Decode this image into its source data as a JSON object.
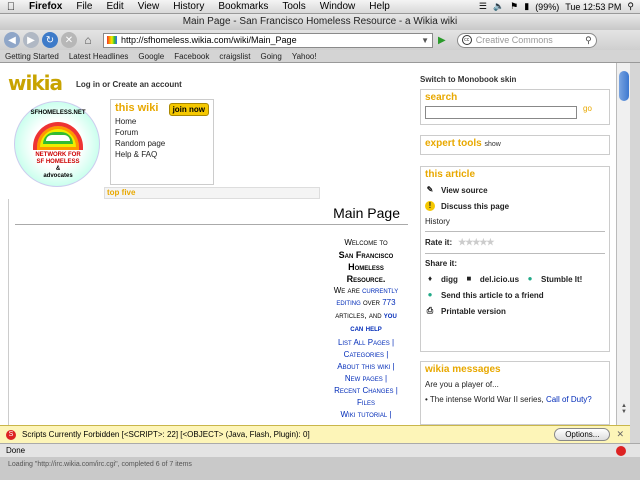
{
  "menubar": {
    "app": "Firefox",
    "items": [
      "File",
      "Edit",
      "View",
      "History",
      "Bookmarks",
      "Tools",
      "Window",
      "Help"
    ],
    "battery": "(99%)",
    "clock": "Tue 12:53 PM"
  },
  "window": {
    "title": "Main Page - San Francisco Homeless Resource - a Wikia wiki"
  },
  "toolbar": {
    "url": "http://sfhomeless.wikia.com/wiki/Main_Page",
    "search_placeholder": "Creative Commons"
  },
  "bookmarks": [
    "Getting Started",
    "Latest Headlines",
    "Google",
    "Facebook",
    "craigslist",
    "Going",
    "Yahoo!"
  ],
  "page": {
    "logo": "wikia",
    "login": "Log in or Create an account",
    "logo_text": {
      "top": "SFHOMELESS.NET",
      "mid1": "NETWORK FOR",
      "mid2": "SF HOMELESS",
      "amp": "&",
      "bot": "advocates"
    },
    "thiswiki": {
      "heading": "this wiki",
      "join": "join now",
      "items": [
        "Home",
        "Forum",
        "Random page",
        "Help & FAQ"
      ]
    },
    "topfive": "top five",
    "article": {
      "title": "Main Page",
      "welcome1": "Welcome to",
      "welcome2": "San Francisco Homeless Resource.",
      "welcome3": "We are",
      "welcome4": "currently editing",
      "welcome5": "over",
      "count": "773",
      "welcome6": "articles, and",
      "welcome7": "you can help",
      "links": [
        "List All Pages",
        "Categories",
        "About this wiki",
        "New pages",
        "Recent Changes",
        "Files",
        "Wiki tutorial"
      ]
    },
    "monobook": "Switch to Monobook skin",
    "search": {
      "heading": "search",
      "go": "go"
    },
    "expert": {
      "heading": "expert tools",
      "show": "show"
    },
    "thisarticle": {
      "heading": "this article",
      "view_source": "View source",
      "discuss": "Discuss this page",
      "history": "History",
      "rate": "Rate it:",
      "share": "Share it:",
      "digg": "digg",
      "delicious": "del.icio.us",
      "stumble": "Stumble It!",
      "send": "Send this article to a friend",
      "printable": "Printable version"
    },
    "wikiamessages": {
      "heading": "wikia messages",
      "item1": "Are you a player of...",
      "item2": "The intense World War II series,",
      "item2_link": "Call of Duty?"
    }
  },
  "notice": {
    "text": "Scripts Currently Forbidden [<SCRIPT>: 22] [<OBJECT> (Java, Flash, Plugin): 0]",
    "options": "Options..."
  },
  "status": {
    "text": "Done",
    "loading": "Loading \"http://irc.wikia.com/irc.cgi\", completed 6 of 7 items"
  }
}
